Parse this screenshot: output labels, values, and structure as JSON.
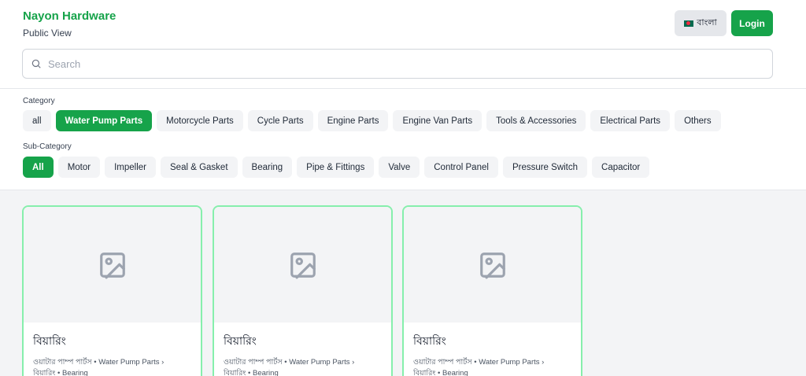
{
  "header": {
    "brand": "Nayon Hardware",
    "subtitle": "Public View",
    "lang_label": "বাংলা",
    "login_label": "Login",
    "search_placeholder": "Search"
  },
  "filters": {
    "category_label": "Category",
    "categories": [
      "all",
      "Water Pump Parts",
      "Motorcycle Parts",
      "Cycle Parts",
      "Engine Parts",
      "Engine Van Parts",
      "Tools & Accessories",
      "Electrical Parts",
      "Others"
    ],
    "active_category": "Water Pump Parts",
    "subcategory_label": "Sub-Category",
    "subcategories": [
      "All",
      "Motor",
      "Impeller",
      "Seal & Gasket",
      "Bearing",
      "Pipe & Fittings",
      "Valve",
      "Control Panel",
      "Pressure Switch",
      "Capacitor"
    ],
    "active_subcategory": "All"
  },
  "products": [
    {
      "title": "বিয়ারিং",
      "path_line1": "ওয়াটার পাম্প পার্টস • Water Pump Parts ›",
      "path_line2": "বিয়ারিং • Bearing"
    },
    {
      "title": "বিয়ারিং",
      "path_line1": "ওয়াটার পাম্প পার্টস • Water Pump Parts ›",
      "path_line2": "বিয়ারিং • Bearing"
    },
    {
      "title": "বিয়ারিং",
      "path_line1": "ওয়াটার পাম্প পার্টস • Water Pump Parts ›",
      "path_line2": "বিয়ারিং • Bearing"
    }
  ],
  "colors": {
    "accent": "#16a34a",
    "card_border": "#86efac",
    "chip_bg": "#f3f4f6"
  }
}
